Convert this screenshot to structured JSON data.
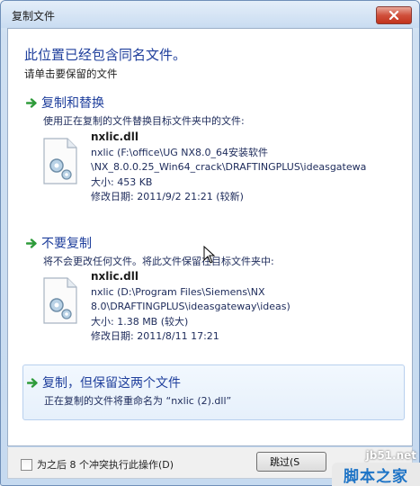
{
  "window": {
    "title": "复制文件"
  },
  "heading": "此位置已经包含同名文件。",
  "subheading": "请单击要保留的文件",
  "options": {
    "replace": {
      "title": "复制和替换",
      "desc": "使用正在复制的文件替换目标文件夹中的文件:",
      "file": {
        "name": "nxlic.dll",
        "path_line1": "nxlic (F:\\office\\UG NX8.0_64安装软件",
        "path_line2": "\\NX_8.0.0.25_Win64_crack\\DRAFTINGPLUS\\ideasgatewa",
        "size": "大小: 453 KB",
        "modified": "修改日期: 2011/9/2 21:21 (较新)"
      }
    },
    "skip": {
      "title": "不要复制",
      "desc": "将不会更改任何文件。将此文件保留在目标文件夹中:",
      "file": {
        "name": "nxlic.dll",
        "path_line1": "nxlic (D:\\Program Files\\Siemens\\NX",
        "path_line2": "8.0\\DRAFTINGPLUS\\ideasgateway\\ideas)",
        "size": "大小: 1.38 MB (较大)",
        "modified": "修改日期: 2011/8/11 17:21"
      }
    },
    "keep_both": {
      "title": "复制，但保留这两个文件",
      "desc": "正在复制的文件将重命名为 “nxlic (2).dll”"
    }
  },
  "footer": {
    "checkbox_label": "为之后 8 个冲突执行此操作(D)",
    "checkbox_checked": false,
    "skip_button": "跳过(S"
  },
  "watermark": {
    "url": "jb51.net",
    "brand": "脚本之家"
  },
  "colors": {
    "heading": "#1f3f9c",
    "arrow": "#2e9b3a"
  }
}
